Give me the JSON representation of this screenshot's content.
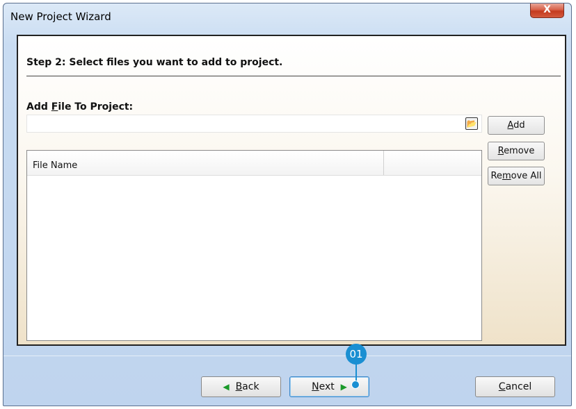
{
  "window": {
    "title": "New Project Wizard",
    "close_glyph": "X"
  },
  "step": {
    "title": "Step 2: Select files you want to add to project."
  },
  "add_file": {
    "label_pre": "Add ",
    "label_key": "F",
    "label_post": "ile To Project:",
    "value": "",
    "browse_icon": "folder-open-icon"
  },
  "side_buttons": {
    "add": {
      "pre": "",
      "key": "A",
      "post": "dd"
    },
    "remove": {
      "pre": "",
      "key": "R",
      "post": "emove"
    },
    "remove_all": {
      "pre": "Re",
      "key": "m",
      "post": "ove All"
    }
  },
  "file_list": {
    "columns": [
      "File Name",
      ""
    ],
    "rows": []
  },
  "footer": {
    "back": {
      "key": "B",
      "post": "ack"
    },
    "next": {
      "key": "N",
      "post": "ext"
    },
    "cancel": {
      "key": "C",
      "post": "ancel"
    }
  },
  "callout": {
    "label": "01",
    "color": "#1a8fd2"
  },
  "colors": {
    "arrow": "#1a9a2a",
    "accent": "#1a8fd2"
  }
}
